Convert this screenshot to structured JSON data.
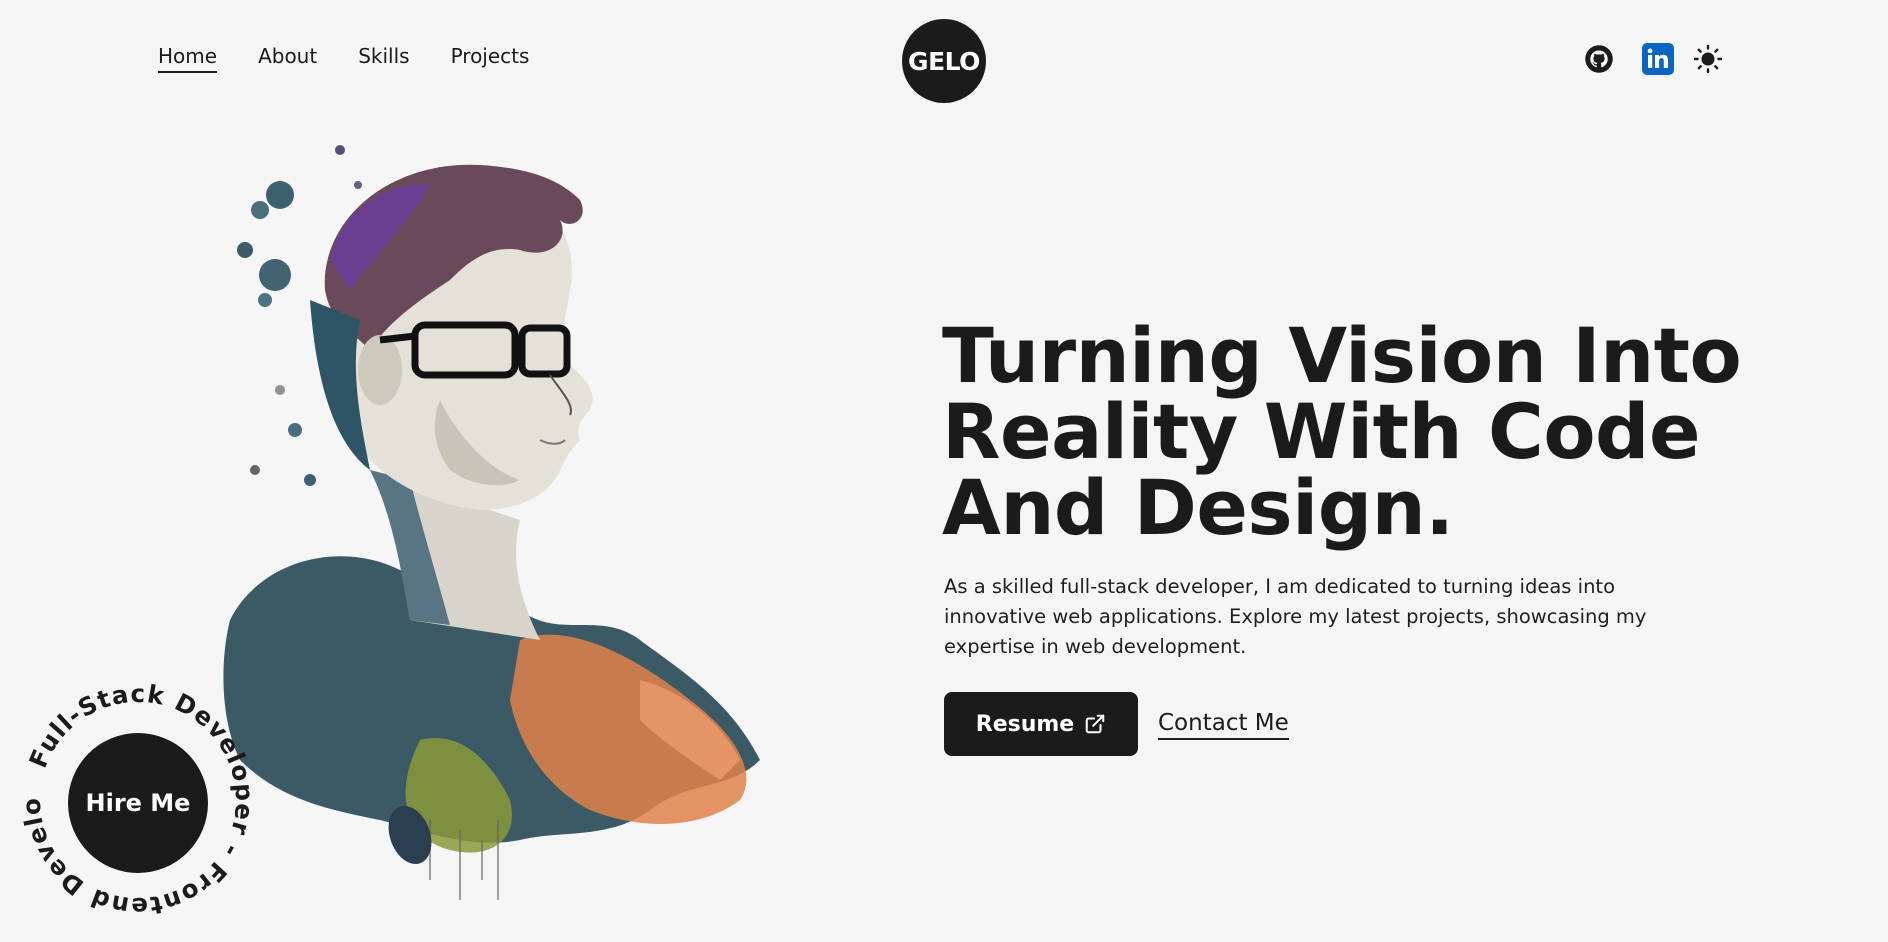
{
  "nav": {
    "items": [
      {
        "label": "Home",
        "active": true
      },
      {
        "label": "About"
      },
      {
        "label": "Skills"
      },
      {
        "label": "Projects"
      }
    ]
  },
  "logo": {
    "text": "GELO"
  },
  "social": {
    "icons": [
      "github-icon",
      "linkedin-icon",
      "sun-icon"
    ]
  },
  "hero": {
    "headline_lines": [
      "Turning Vision Into",
      "Reality With Code",
      "And Design."
    ],
    "intro": "As a skilled full-stack developer, I am dedicated to turning ideas into innovative web applications. Explore my latest projects, showcasing my expertise in web development.",
    "resume_label": "Resume",
    "contact_label": "Contact Me"
  },
  "hire": {
    "label": "Hire Me",
    "ring_text": "Full-Stack Developer - Frontend Developer - Backend Developer - "
  },
  "colors": {
    "background": "#f5f5f5",
    "dark": "#1b1b1b",
    "linkedin": "#0a66c2"
  }
}
